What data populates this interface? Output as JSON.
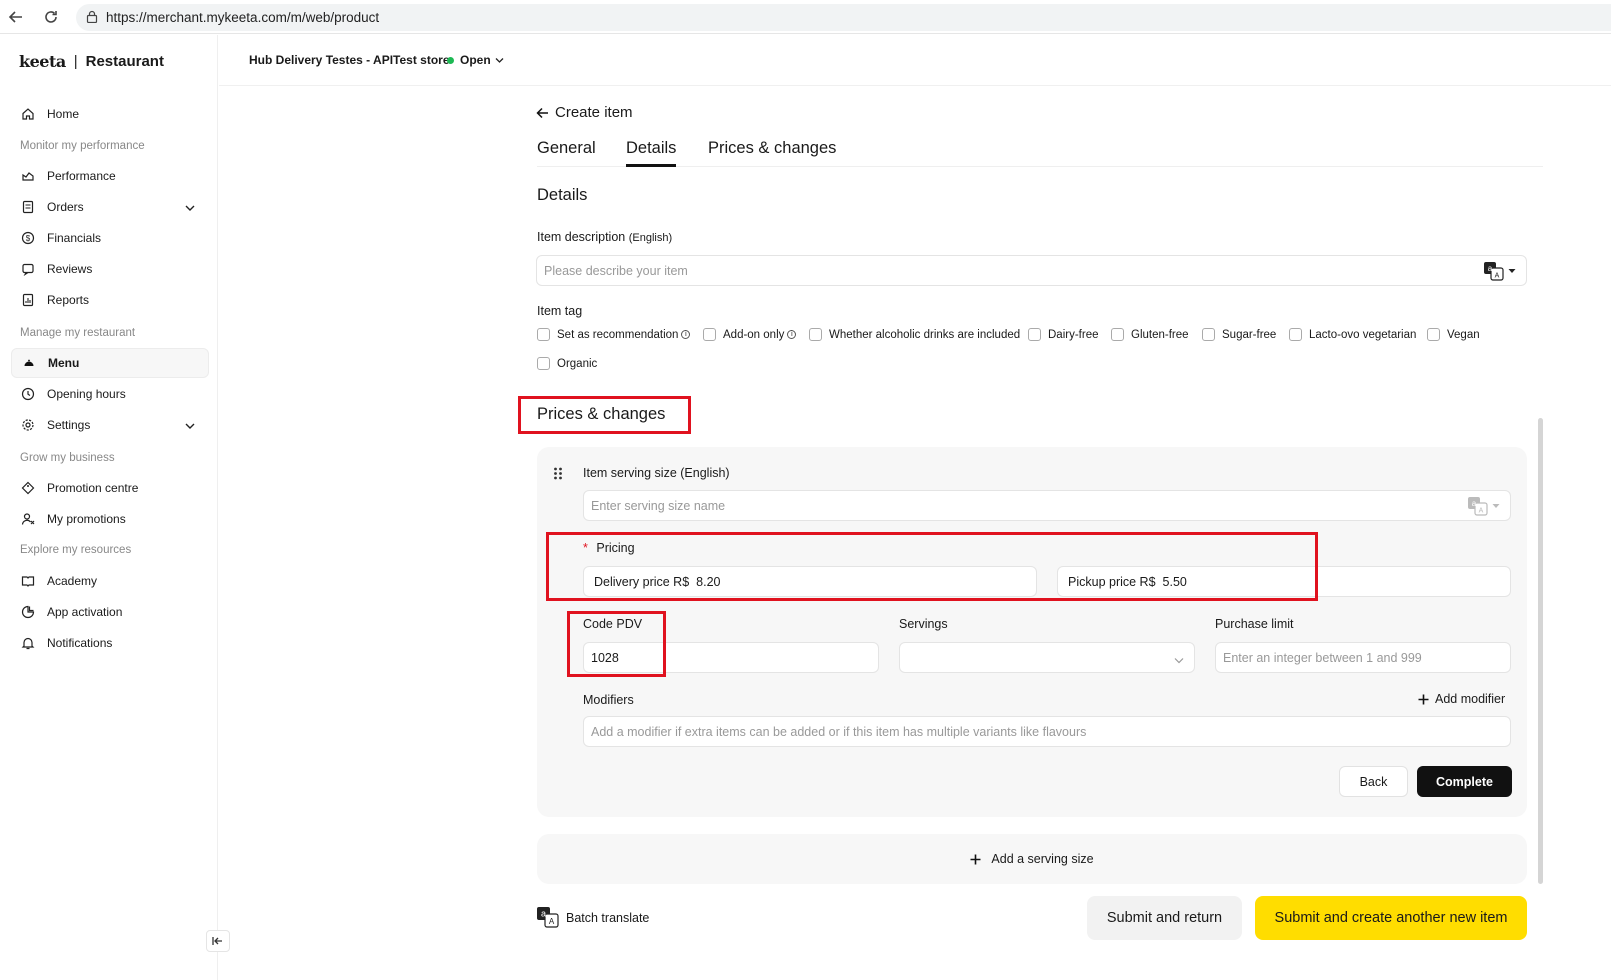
{
  "browser": {
    "url": "https://merchant.mykeeta.com/m/web/product"
  },
  "brand": {
    "logo": "keeta",
    "separator": "|",
    "name": "Restaurant"
  },
  "sidebar": {
    "home": "Home",
    "group_monitor": "Monitor my performance",
    "performance": "Performance",
    "orders": "Orders",
    "financials": "Financials",
    "reviews": "Reviews",
    "reports": "Reports",
    "group_manage": "Manage my restaurant",
    "menu": "Menu",
    "opening_hours": "Opening hours",
    "settings": "Settings",
    "group_grow": "Grow my business",
    "promotion_centre": "Promotion centre",
    "my_promotions": "My promotions",
    "group_explore": "Explore my resources",
    "academy": "Academy",
    "app_activation": "App activation",
    "notifications": "Notifications"
  },
  "header": {
    "store_name": "Hub Delivery Testes - APITest store",
    "status": "Open",
    "status_color": "#1db954"
  },
  "page": {
    "back_title": "Create item",
    "tabs": [
      "General",
      "Details",
      "Prices & changes"
    ],
    "active_tab": "Details",
    "details_title": "Details",
    "item_description_label": "Item description",
    "item_description_lang": "(English)",
    "item_description_placeholder": "Please describe your item",
    "item_tag_label": "Item tag",
    "tags": [
      "Set as recommendation",
      "Add-on only",
      "Whether alcoholic drinks are included",
      "Dairy-free",
      "Gluten-free",
      "Sugar-free",
      "Lacto-ovo vegetarian",
      "Vegan",
      "Organic"
    ],
    "prices_title": "Prices & changes",
    "serving_size_label": "Item serving size",
    "serving_size_lang": "(English)",
    "serving_size_placeholder": "Enter serving size name",
    "pricing_required": "*",
    "pricing_label": "Pricing",
    "delivery_price_label": "Delivery price R$",
    "delivery_price_value": "8.20",
    "pickup_price_label": "Pickup price R$",
    "pickup_price_value": "5.50",
    "code_pdv_label": "Code PDV",
    "code_pdv_value": "1028",
    "servings_label": "Servings",
    "purchase_limit_label": "Purchase limit",
    "purchase_limit_placeholder": "Enter an integer between 1 and 999",
    "modifiers_label": "Modifiers",
    "add_modifier": "Add modifier",
    "modifiers_placeholder": "Add a modifier if extra items can be added or if this item has multiple variants like flavours",
    "back_btn": "Back",
    "complete_btn": "Complete",
    "add_serving_size": "Add a serving size",
    "batch_translate": "Batch translate",
    "submit_return": "Submit and return",
    "submit_new": "Submit and create another new item",
    "accent_color": "#ffdd00",
    "highlight_color": "#e0121f"
  }
}
